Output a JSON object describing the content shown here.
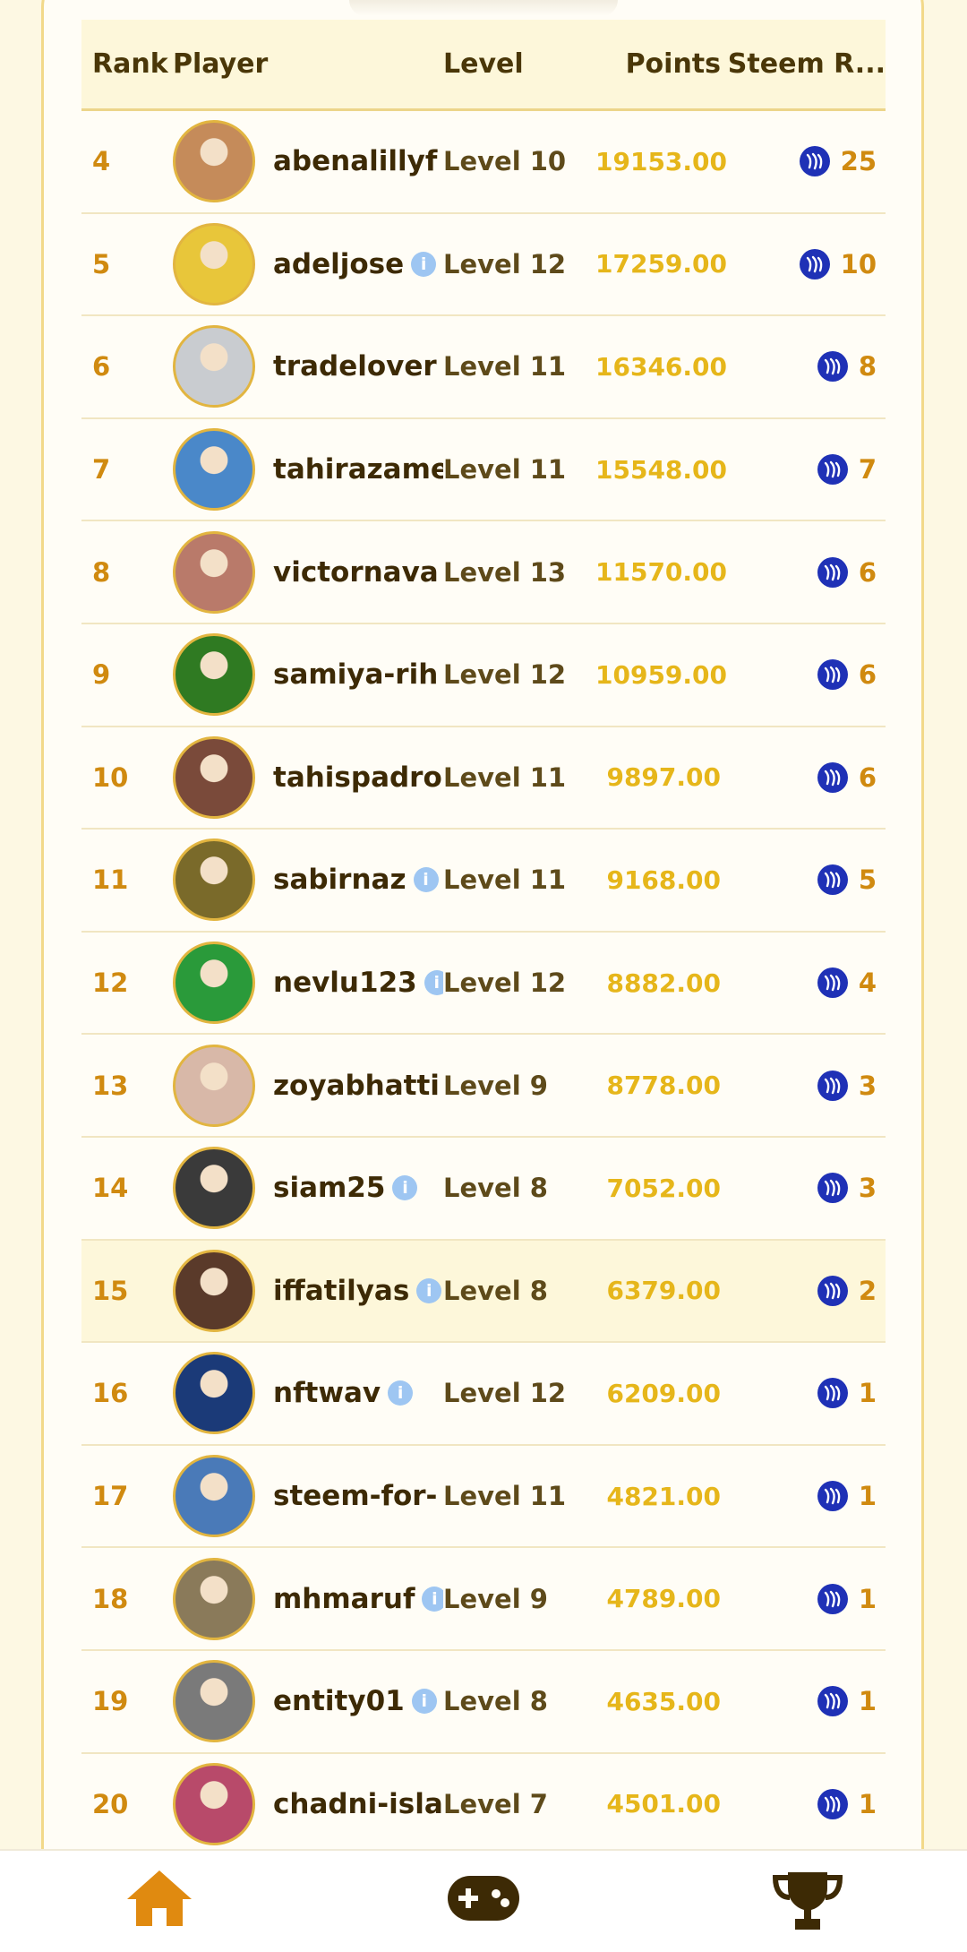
{
  "table": {
    "headers": {
      "rank": "Rank",
      "player": "Player",
      "level": "Level",
      "points": "Points",
      "steem": "Steem R..."
    },
    "rows": [
      {
        "rank": "4",
        "player": "abenalillyf",
        "info": false,
        "level": "Level 10",
        "points": "19153.00",
        "steem": "25",
        "avatar": "#c58b5a"
      },
      {
        "rank": "5",
        "player": "adeljose",
        "info": true,
        "level": "Level 12",
        "points": "17259.00",
        "steem": "10",
        "avatar": "#e8c63a"
      },
      {
        "rank": "6",
        "player": "tradelover",
        "info": false,
        "level": "Level 11",
        "points": "16346.00",
        "steem": "8",
        "avatar": "#c9ccd0"
      },
      {
        "rank": "7",
        "player": "tahirazame",
        "info": false,
        "level": "Level 11",
        "points": "15548.00",
        "steem": "7",
        "avatar": "#4a88c9"
      },
      {
        "rank": "8",
        "player": "victornava",
        "info": false,
        "level": "Level 13",
        "points": "11570.00",
        "steem": "6",
        "avatar": "#b97a6a"
      },
      {
        "rank": "9",
        "player": "samiya-rih",
        "info": false,
        "level": "Level 12",
        "points": "10959.00",
        "steem": "6",
        "avatar": "#2f7a22"
      },
      {
        "rank": "10",
        "player": "tahispadro",
        "info": false,
        "level": "Level 11",
        "points": "9897.00",
        "steem": "6",
        "avatar": "#7a4a3a"
      },
      {
        "rank": "11",
        "player": "sabirnaz",
        "info": true,
        "level": "Level 11",
        "points": "9168.00",
        "steem": "5",
        "avatar": "#7a6a2a"
      },
      {
        "rank": "12",
        "player": "nevlu123",
        "info": true,
        "level": "Level 12",
        "points": "8882.00",
        "steem": "4",
        "avatar": "#2a9a3a"
      },
      {
        "rank": "13",
        "player": "zoyabhatti",
        "info": false,
        "level": "Level 9",
        "points": "8778.00",
        "steem": "3",
        "avatar": "#d8b8a8"
      },
      {
        "rank": "14",
        "player": "siam25",
        "info": true,
        "level": "Level 8",
        "points": "7052.00",
        "steem": "3",
        "avatar": "#3a3a3a"
      },
      {
        "rank": "15",
        "player": "iffatilyas",
        "info": true,
        "level": "Level 8",
        "points": "6379.00",
        "steem": "2",
        "avatar": "#5a3a2a",
        "highlight": true
      },
      {
        "rank": "16",
        "player": "nftwav",
        "info": true,
        "level": "Level 12",
        "points": "6209.00",
        "steem": "1",
        "avatar": "#1b3a78"
      },
      {
        "rank": "17",
        "player": "steem-for-",
        "info": false,
        "level": "Level 11",
        "points": "4821.00",
        "steem": "1",
        "avatar": "#4a7ab8"
      },
      {
        "rank": "18",
        "player": "mhmaruf",
        "info": true,
        "level": "Level 9",
        "points": "4789.00",
        "steem": "1",
        "avatar": "#8a7a5a"
      },
      {
        "rank": "19",
        "player": "entity01",
        "info": true,
        "level": "Level 8",
        "points": "4635.00",
        "steem": "1",
        "avatar": "#7a7a7a"
      },
      {
        "rank": "20",
        "player": "chadni-isla",
        "info": false,
        "level": "Level 7",
        "points": "4501.00",
        "steem": "1",
        "avatar": "#b84a6a"
      }
    ]
  },
  "nav": {
    "items": [
      {
        "name": "home",
        "icon": "home-icon",
        "color": "#e08a10"
      },
      {
        "name": "games",
        "icon": "gamepad-icon",
        "color": "#3d2a05"
      },
      {
        "name": "leaderboard",
        "icon": "trophy-icon",
        "color": "#3d2a05"
      }
    ]
  },
  "colors": {
    "accent": "#e08a10",
    "steem": "#1f31b6",
    "points": "#e6b61a"
  }
}
